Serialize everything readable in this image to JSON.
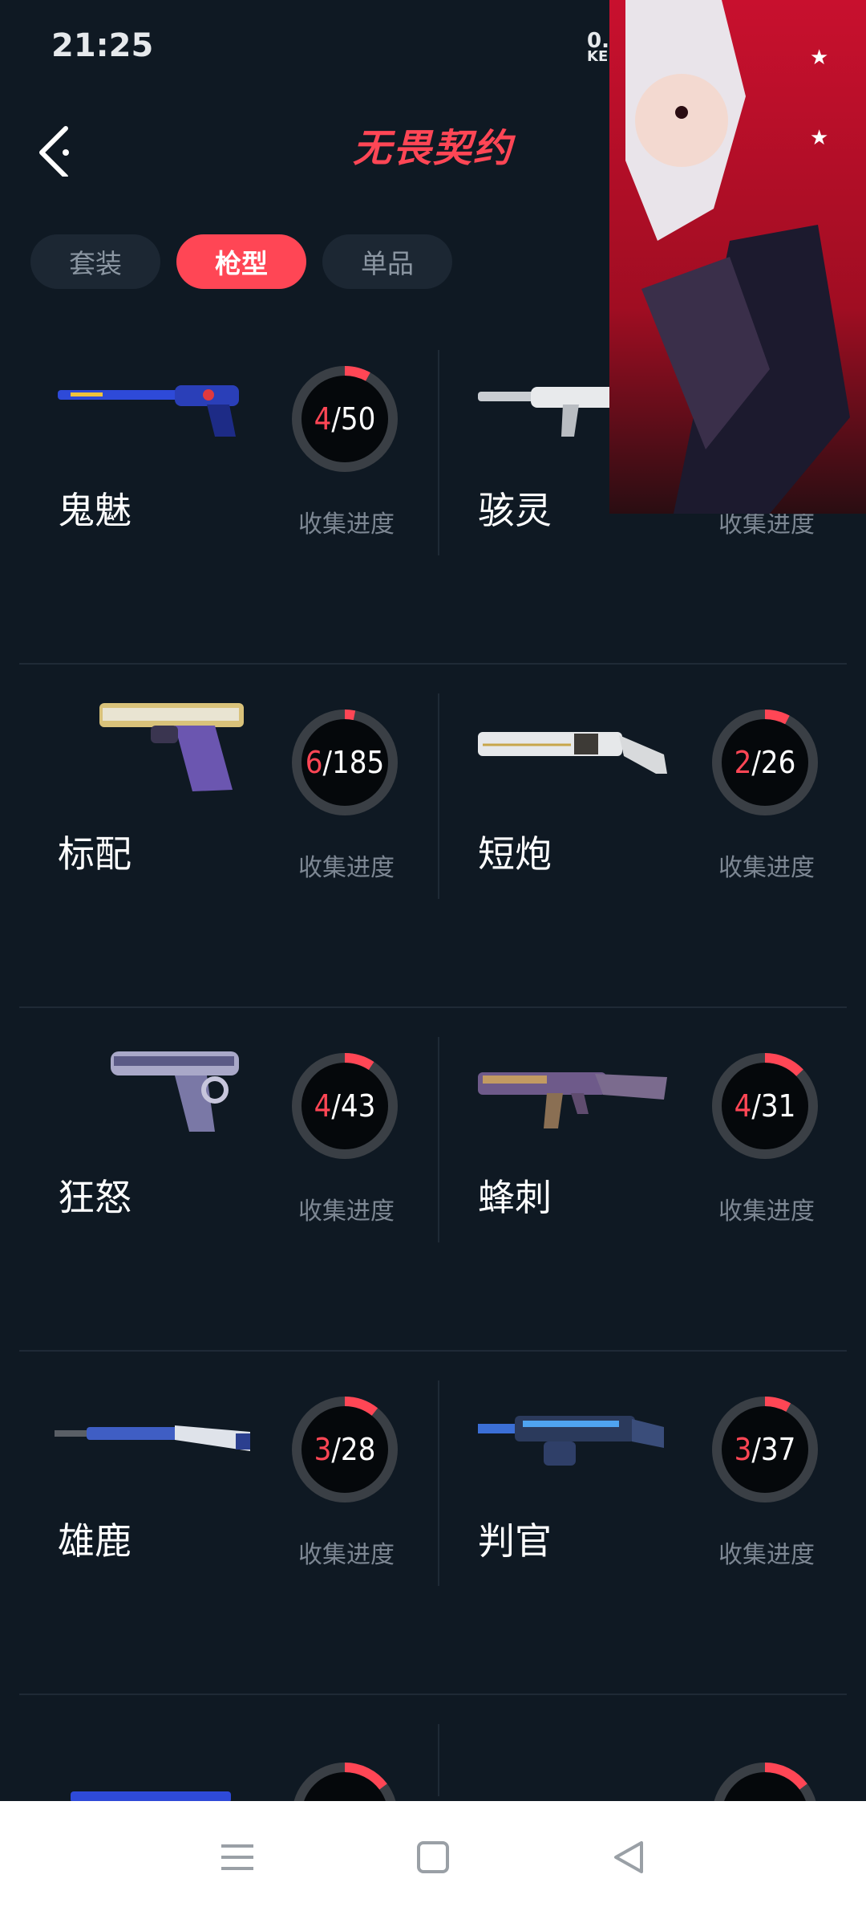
{
  "status": {
    "time": "21:25",
    "net_value": "0.",
    "net_unit": "KE"
  },
  "header": {
    "title": "无畏契约"
  },
  "tabs": [
    {
      "label": "套装",
      "active": false
    },
    {
      "label": "枪型",
      "active": true
    },
    {
      "label": "单品",
      "active": false
    }
  ],
  "progress_label": "收集进度",
  "guns": [
    {
      "name": "鬼魅",
      "collected": "4",
      "total": "50",
      "fraction": 0.08
    },
    {
      "name": "骇灵",
      "collected": "",
      "total": "",
      "fraction": 0
    },
    {
      "name": "标配",
      "collected": "6",
      "total": "185",
      "fraction": 0.032
    },
    {
      "name": "短炮",
      "collected": "2",
      "total": "26",
      "fraction": 0.077
    },
    {
      "name": "狂怒",
      "collected": "4",
      "total": "43",
      "fraction": 0.093
    },
    {
      "name": "蜂刺",
      "collected": "4",
      "total": "31",
      "fraction": 0.129
    },
    {
      "name": "雄鹿",
      "collected": "3",
      "total": "28",
      "fraction": 0.107
    },
    {
      "name": "判官",
      "collected": "3",
      "total": "37",
      "fraction": 0.081
    }
  ],
  "colors": {
    "accent": "#ff4655",
    "background": "#0f1923",
    "ring_track": "#3a3f45"
  },
  "nav": {
    "icons": [
      "menu-icon",
      "home-icon",
      "back-triangle-icon"
    ]
  }
}
